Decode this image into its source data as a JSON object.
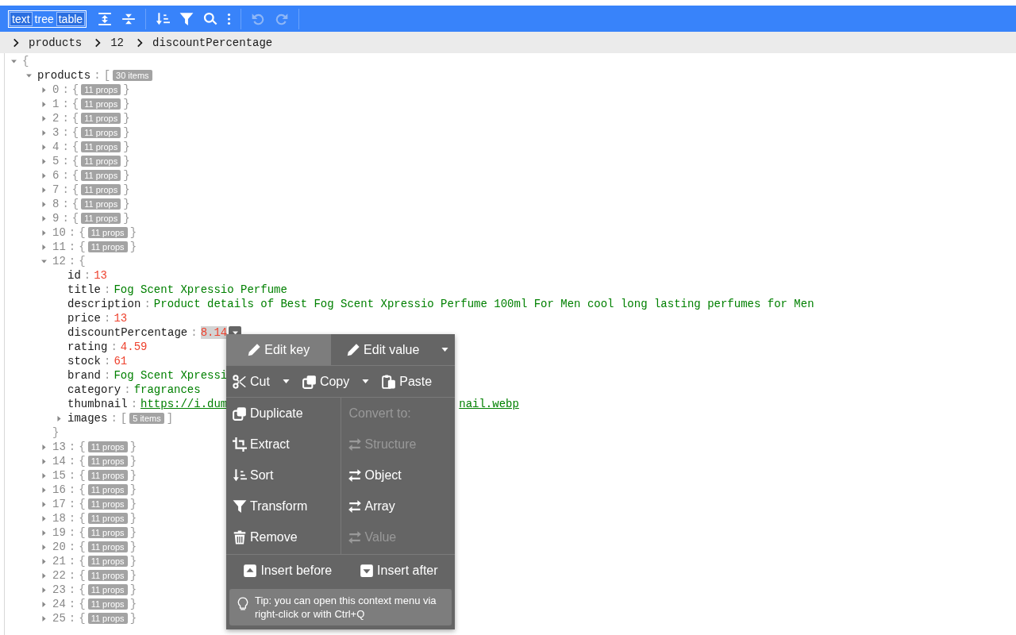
{
  "toolbar": {
    "modes": [
      {
        "label": "text",
        "selected": false
      },
      {
        "label": "tree",
        "selected": true
      },
      {
        "label": "table",
        "selected": false
      }
    ],
    "buttons": [
      {
        "kind": "expand-all",
        "disabled": false
      },
      {
        "kind": "collapse-all",
        "disabled": false
      },
      {
        "kind": "sort",
        "disabled": false
      },
      {
        "kind": "filter",
        "disabled": false
      },
      {
        "kind": "search",
        "disabled": false
      },
      {
        "kind": "more",
        "disabled": false
      },
      {
        "kind": "undo",
        "disabled": true
      },
      {
        "kind": "redo",
        "disabled": true
      }
    ]
  },
  "breadcrumb": [
    "products",
    "12",
    "discountPercentage"
  ],
  "tree": {
    "kind": "object",
    "expanded": true,
    "open": "{",
    "children": [
      {
        "key": "products",
        "colon": ":",
        "kind": "array",
        "expanded": true,
        "open": "[",
        "badge": "30 items",
        "children": [
          {
            "key": "0",
            "colon": ":",
            "kind": "object",
            "expanded": false,
            "open": "{",
            "badge": "11 props",
            "close": "}"
          },
          {
            "key": "1",
            "colon": ":",
            "kind": "object",
            "expanded": false,
            "open": "{",
            "badge": "11 props",
            "close": "}"
          },
          {
            "key": "2",
            "colon": ":",
            "kind": "object",
            "expanded": false,
            "open": "{",
            "badge": "11 props",
            "close": "}"
          },
          {
            "key": "3",
            "colon": ":",
            "kind": "object",
            "expanded": false,
            "open": "{",
            "badge": "11 props",
            "close": "}"
          },
          {
            "key": "4",
            "colon": ":",
            "kind": "object",
            "expanded": false,
            "open": "{",
            "badge": "11 props",
            "close": "}"
          },
          {
            "key": "5",
            "colon": ":",
            "kind": "object",
            "expanded": false,
            "open": "{",
            "badge": "11 props",
            "close": "}"
          },
          {
            "key": "6",
            "colon": ":",
            "kind": "object",
            "expanded": false,
            "open": "{",
            "badge": "11 props",
            "close": "}"
          },
          {
            "key": "7",
            "colon": ":",
            "kind": "object",
            "expanded": false,
            "open": "{",
            "badge": "11 props",
            "close": "}"
          },
          {
            "key": "8",
            "colon": ":",
            "kind": "object",
            "expanded": false,
            "open": "{",
            "badge": "11 props",
            "close": "}"
          },
          {
            "key": "9",
            "colon": ":",
            "kind": "object",
            "expanded": false,
            "open": "{",
            "badge": "11 props",
            "close": "}"
          },
          {
            "key": "10",
            "colon": ":",
            "kind": "object",
            "expanded": false,
            "open": "{",
            "badge": "11 props",
            "close": "}"
          },
          {
            "key": "11",
            "colon": ":",
            "kind": "object",
            "expanded": false,
            "open": "{",
            "badge": "11 props",
            "close": "}"
          },
          {
            "key": "12",
            "colon": ":",
            "kind": "object",
            "expanded": true,
            "open": "{",
            "close": "}",
            "children": [
              {
                "key": "id",
                "colon": ":",
                "kind": "number",
                "value": "13",
                "selected": false
              },
              {
                "key": "title",
                "colon": ":",
                "kind": "string",
                "value": "Fog Scent Xpressio Perfume",
                "selected": false
              },
              {
                "key": "description",
                "colon": ":",
                "kind": "string",
                "value": "Product details of Best Fog Scent Xpressio Perfume 100ml For Men cool long lasting perfumes for Men",
                "selected": false
              },
              {
                "key": "price",
                "colon": ":",
                "kind": "number",
                "value": "13",
                "selected": false
              },
              {
                "key": "discountPercentage",
                "colon": ":",
                "kind": "number",
                "value": "8.14",
                "selected": true
              },
              {
                "key": "rating",
                "colon": ":",
                "kind": "number",
                "value": "4.59",
                "selected": false
              },
              {
                "key": "stock",
                "colon": ":",
                "kind": "number",
                "value": "61",
                "selected": false
              },
              {
                "key": "brand",
                "colon": ":",
                "kind": "string",
                "value": "Fog Scent Xpressi",
                "selected": false
              },
              {
                "key": "category",
                "colon": ":",
                "kind": "string",
                "value": "fragrances",
                "selected": false
              },
              {
                "key": "thumbnail",
                "colon": ":",
                "kind": "url",
                "value": "https://i.dum",
                "value_tail": "nail.webp",
                "selected": false
              },
              {
                "key": "images",
                "colon": ":",
                "kind": "array",
                "expanded": false,
                "open": "[",
                "badge": "5 items",
                "close": "]",
                "selected": false
              }
            ]
          },
          {
            "key": "13",
            "colon": ":",
            "kind": "object",
            "expanded": false,
            "open": "{",
            "badge": "11 props",
            "close": "}"
          },
          {
            "key": "14",
            "colon": ":",
            "kind": "object",
            "expanded": false,
            "open": "{",
            "badge": "11 props",
            "close": "}"
          },
          {
            "key": "15",
            "colon": ":",
            "kind": "object",
            "expanded": false,
            "open": "{",
            "badge": "11 props",
            "close": "}"
          },
          {
            "key": "16",
            "colon": ":",
            "kind": "object",
            "expanded": false,
            "open": "{",
            "badge": "11 props",
            "close": "}"
          },
          {
            "key": "17",
            "colon": ":",
            "kind": "object",
            "expanded": false,
            "open": "{",
            "badge": "11 props",
            "close": "}"
          },
          {
            "key": "18",
            "colon": ":",
            "kind": "object",
            "expanded": false,
            "open": "{",
            "badge": "11 props",
            "close": "}"
          },
          {
            "key": "19",
            "colon": ":",
            "kind": "object",
            "expanded": false,
            "open": "{",
            "badge": "11 props",
            "close": "}"
          },
          {
            "key": "20",
            "colon": ":",
            "kind": "object",
            "expanded": false,
            "open": "{",
            "badge": "11 props",
            "close": "}"
          },
          {
            "key": "21",
            "colon": ":",
            "kind": "object",
            "expanded": false,
            "open": "{",
            "badge": "11 props",
            "close": "}"
          },
          {
            "key": "22",
            "colon": ":",
            "kind": "object",
            "expanded": false,
            "open": "{",
            "badge": "11 props",
            "close": "}"
          },
          {
            "key": "23",
            "colon": ":",
            "kind": "object",
            "expanded": false,
            "open": "{",
            "badge": "11 props",
            "close": "}"
          },
          {
            "key": "24",
            "colon": ":",
            "kind": "object",
            "expanded": false,
            "open": "{",
            "badge": "11 props",
            "close": "}"
          },
          {
            "key": "25",
            "colon": ":",
            "kind": "object",
            "expanded": false,
            "open": "{",
            "badge": "11 props",
            "close": "}"
          }
        ]
      }
    ]
  },
  "context_menu": {
    "top": [
      {
        "label": "Edit key",
        "kind": "pencil",
        "selected": true,
        "dropdown": false
      },
      {
        "label": "Edit value",
        "kind": "pencil",
        "selected": false,
        "dropdown": true
      }
    ],
    "clipboard": [
      {
        "label": "Cut",
        "kind": "scissors",
        "dropdown": true
      },
      {
        "label": "Copy",
        "kind": "copy",
        "dropdown": true
      },
      {
        "label": "Paste",
        "kind": "paste",
        "dropdown": false
      }
    ],
    "actions": [
      {
        "label": "Duplicate",
        "kind": "duplicate"
      },
      {
        "label": "Extract",
        "kind": "crop"
      },
      {
        "label": "Sort",
        "kind": "sort"
      },
      {
        "label": "Transform",
        "kind": "filter"
      },
      {
        "label": "Remove",
        "kind": "trash"
      }
    ],
    "convert_label": "Convert to:",
    "convert": [
      {
        "label": "Structure",
        "disabled": true
      },
      {
        "label": "Object",
        "disabled": false
      },
      {
        "label": "Array",
        "disabled": false
      },
      {
        "label": "Value",
        "disabled": true
      }
    ],
    "insert": [
      {
        "label": "Insert before",
        "kind": "insert-before"
      },
      {
        "label": "Insert after",
        "kind": "insert-after"
      }
    ],
    "tip": "Tip: you can open this context menu via right-click or with Ctrl+Q"
  }
}
